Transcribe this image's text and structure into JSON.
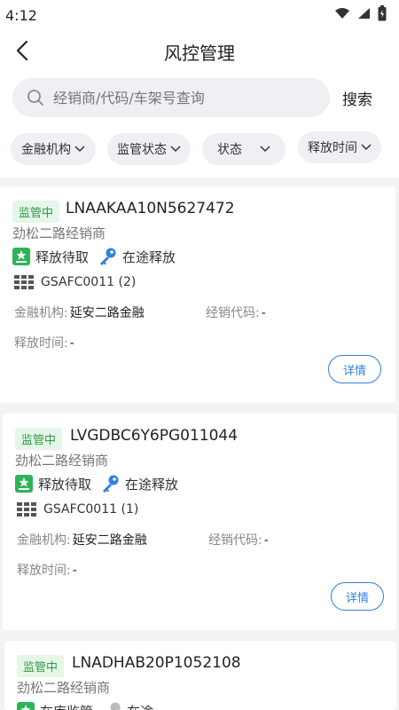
{
  "status_bar": {
    "time": "4:12"
  },
  "header": {
    "title": "风控管理"
  },
  "search": {
    "placeholder": "经销商/代码/车架号查询",
    "button_label": "搜索"
  },
  "filters": [
    {
      "label": "金融机构"
    },
    {
      "label": "监管状态"
    },
    {
      "label": "状态"
    },
    {
      "label": "释放时间"
    }
  ],
  "cards": [
    {
      "status_badge": "监管中",
      "vin": "LNAAKAA10N5627472",
      "dealer": "劲松二路经销商",
      "tags": [
        "释放待取",
        "在途释放"
      ],
      "gsa": "GSAFC0011 (2)",
      "finance_label": "金融机构:",
      "finance_value": "延安二路金融",
      "dealer_code_label": "经销代码:",
      "dealer_code_value": "-",
      "release_time_label": "释放时间:",
      "release_time_value": "-",
      "detail_label": "详情"
    },
    {
      "status_badge": "监管中",
      "vin": "LVGDBC6Y6PG011044",
      "dealer": "劲松二路经销商",
      "tags": [
        "释放待取",
        "在途释放"
      ],
      "gsa": "GSAFC0011 (1)",
      "finance_label": "金融机构:",
      "finance_value": "延安二路金融",
      "dealer_code_label": "经销代码:",
      "dealer_code_value": "-",
      "release_time_label": "释放时间:",
      "release_time_value": "-",
      "detail_label": "详情"
    },
    {
      "status_badge": "监管中",
      "vin": "LNADHAB20P1052108",
      "dealer": "劲松二路经销商",
      "tags": [
        "在库监管",
        "在途"
      ]
    }
  ],
  "colors": {
    "accent": "#2f7fe0",
    "badge_green": "#2e9b46",
    "badge_bg": "#e6f6e9"
  }
}
